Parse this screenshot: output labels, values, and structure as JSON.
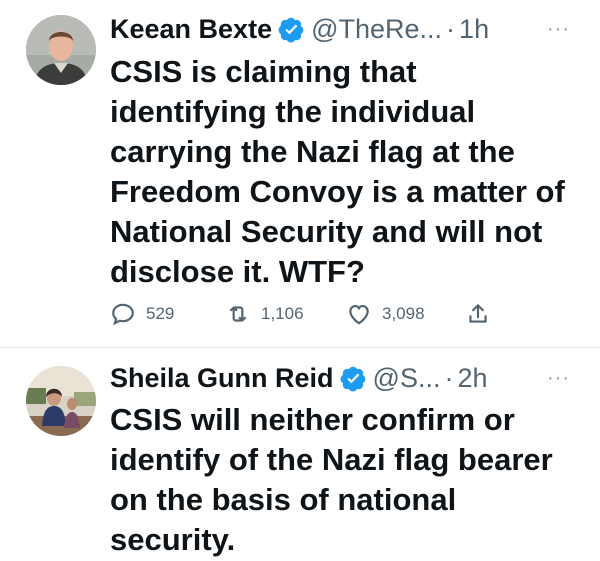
{
  "tweets": [
    {
      "author_name": "Keean Bexte",
      "handle": "@TheRe...",
      "separator": "·",
      "time": "1h",
      "text": "CSIS is claiming that identifying the individual carrying the Nazi flag at the Freedom Convoy is a matter of National Security and will not disclose it. WTF?",
      "replies": "529",
      "retweets": "1,106",
      "likes": "3,098",
      "more": "···"
    },
    {
      "author_name": "Sheila Gunn Reid",
      "handle": "@S...",
      "separator": "·",
      "time": "2h",
      "text": "CSIS will neither confirm or identify of the Nazi flag bearer on the basis of national security.",
      "more": "···"
    }
  ],
  "colors": {
    "verified": "#1d9bf0",
    "secondary_text": "#536471",
    "primary_text": "#0f1419"
  }
}
